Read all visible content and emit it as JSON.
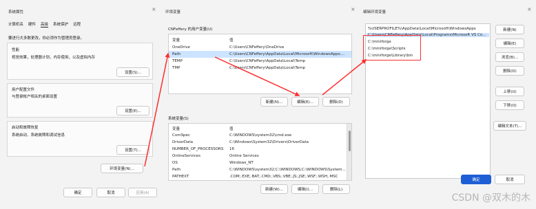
{
  "sys_props": {
    "title": "系统属性",
    "tabs": [
      "计算机名",
      "硬件",
      "高级",
      "系统保护",
      "远程"
    ],
    "admin_note": "要进行大多数更改，你必须作为管理员登录。",
    "performance": {
      "heading": "性能",
      "desc": "视觉效果，处理器计划，内存使用，以及虚拟内存",
      "button": "设置(S)..."
    },
    "profiles": {
      "heading": "用户配置文件",
      "desc": "与登录帐户相关的桌面设置",
      "button": "设置(E)..."
    },
    "startup": {
      "heading": "启动和故障恢复",
      "desc": "系统启动、系统故障和调试信息",
      "button": "设置(T)..."
    },
    "env_button": "环境变量(N)...",
    "ok": "确定",
    "cancel": "取消",
    "apply": "应用(A)"
  },
  "env_vars": {
    "title": "环境变量",
    "user_section": "CNFeffery 的用户变量(U)",
    "col_var": "变量",
    "col_val": "值",
    "user_rows": [
      {
        "name": "OneDrive",
        "value": "C:\\Users\\CNFeffery\\OneDrive"
      },
      {
        "name": "Path",
        "value": "C:\\Users\\CNFeffery\\AppData\\Local\\Microsoft\\WindowsApps;..."
      },
      {
        "name": "TEMP",
        "value": "C:\\Users\\CNFeffery\\AppData\\Local\\Temp"
      },
      {
        "name": "TMP",
        "value": "C:\\Users\\CNFeffery\\AppData\\Local\\Temp"
      }
    ],
    "user_buttons": [
      "新建(N)...",
      "编辑(E)...",
      "删除(D)"
    ],
    "sys_section": "系统变量(S)",
    "sys_rows": [
      {
        "name": "ComSpec",
        "value": "C:\\WINDOWS\\system32\\cmd.exe"
      },
      {
        "name": "DriverData",
        "value": "C:\\Windows\\System32\\Drivers\\DriverData"
      },
      {
        "name": "NUMBER_OF_PROCESSORS",
        "value": "16"
      },
      {
        "name": "OnlineServices",
        "value": "Online Services"
      },
      {
        "name": "OS",
        "value": "Windows_NT"
      },
      {
        "name": "Path",
        "value": "C:\\WINDOWS\\system32;C:\\WINDOWS;C:\\WINDOWS\\System..."
      },
      {
        "name": "PATHEXT",
        "value": ".COM;.EXE;.BAT;.CMD;.VBS;.VBE;.JS;.JSE;.WSF;.WSH;.MSC"
      }
    ],
    "sys_buttons": [
      "新建(W)...",
      "编辑(I)...",
      "删除(L)"
    ]
  },
  "edit_env": {
    "title": "编辑环境变量",
    "entries": [
      "%USERPROFILE%\\AppData\\Local\\Microsoft\\WindowsApps",
      "C:\\Users\\CNFeffery\\AppData\\Local\\Programs\\Microsoft VS Co...",
      "C:\\miniforge",
      "C:\\miniforge\\Scripts",
      "C:\\miniforge\\Library\\bin"
    ],
    "buttons": [
      "新建(N)",
      "编辑(E)",
      "浏览(B)...",
      "删除(D)",
      "上移(U)",
      "下移(O)",
      "编辑文本(T)..."
    ],
    "ok": "确定",
    "cancel": "取消"
  },
  "close_glyph": "×",
  "watermark": "CSDN @双木的木",
  "colors": {
    "highlight": "#ff2d2d",
    "selection": "#cce4ff",
    "primary": "#1f5fd6"
  }
}
